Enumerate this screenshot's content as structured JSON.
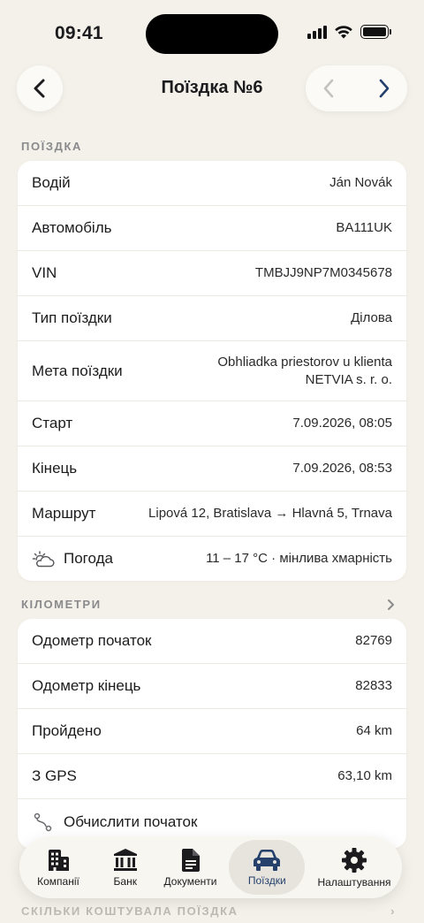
{
  "status": {
    "time": "09:41"
  },
  "nav": {
    "title": "Поїздка №6"
  },
  "trip_section": {
    "header": "ПОЇЗДКА",
    "rows": [
      {
        "label": "Водій",
        "value": "Ján Novák"
      },
      {
        "label": "Автомобіль",
        "value": "BA111UK"
      },
      {
        "label": "VIN",
        "value": "TMBJJ9NP7M0345678"
      },
      {
        "label": "Тип поїздки",
        "value": "Ділова"
      },
      {
        "label": "Мета поїздки",
        "value_line1": "Obhliadka priestorov u klienta",
        "value_line2": "NETVIA s. r. o."
      },
      {
        "label": "Старт",
        "value": "7.09.2026, 08:05"
      },
      {
        "label": "Кінець",
        "value": "7.09.2026, 08:53"
      },
      {
        "label": "Маршрут",
        "value": "Lipová 12, Bratislava → Hlavná 5, Trnava"
      },
      {
        "label": "Погода",
        "value": "11 – 17 °C · мінлива хмарність",
        "icon": "partly-cloudy-icon"
      }
    ]
  },
  "km_section": {
    "header": "КІЛОМЕТРИ",
    "rows": [
      {
        "label": "Одометр початок",
        "value": "82769"
      },
      {
        "label": "Одометр кінець",
        "value": "82833"
      },
      {
        "label": "Пройдено",
        "value": "64 km"
      },
      {
        "label": "З GPS",
        "value": "63,10 km"
      }
    ],
    "action": {
      "label": "Обчислити початок",
      "icon": "route-icon"
    }
  },
  "cost_section": {
    "header": "СКІЛЬКИ КОШТУВАЛА ПОЇЗДКА"
  },
  "tabbar": {
    "active": "trips",
    "tabs": [
      {
        "id": "companies",
        "label": "Компанії",
        "icon": "building-icon"
      },
      {
        "id": "bank",
        "label": "Банк",
        "icon": "bank-icon"
      },
      {
        "id": "documents",
        "label": "Документи",
        "icon": "document-icon"
      },
      {
        "id": "trips",
        "label": "Поїздки",
        "icon": "car-icon"
      },
      {
        "id": "settings",
        "label": "Налаштування",
        "icon": "gear-icon"
      }
    ]
  },
  "colors": {
    "background": "#f4f1ea",
    "accent": "#24406b",
    "card": "#ffffff"
  }
}
